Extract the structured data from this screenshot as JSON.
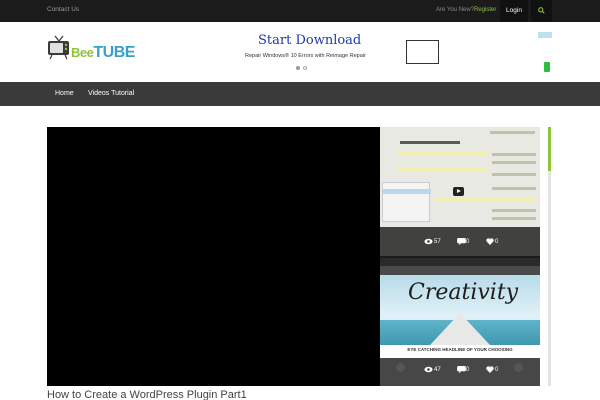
{
  "topbar": {
    "contact": "Contact Us",
    "new_user": "Are You New?",
    "register": "Register",
    "login": "Login"
  },
  "header": {
    "logo": {
      "text_prefix": "Bee",
      "text_main": "TUBE"
    }
  },
  "ad": {
    "title": "Start Download",
    "subtitle": "Repair Windows® 10 Errors with Reimage Repair"
  },
  "nav": {
    "items": [
      {
        "label": "Home"
      },
      {
        "label": "Videos Tutorial"
      }
    ]
  },
  "playlist": {
    "items": [
      {
        "views": "57",
        "comments": "0",
        "likes": "0"
      },
      {
        "views": "47",
        "comments": "0",
        "likes": "0",
        "image_text": "Creativity",
        "headline": "EYE CATCHING HEADLINE OF YOUR CHOOSING"
      }
    ]
  },
  "video": {
    "title": "How to Create a WordPress Plugin Part1"
  },
  "colors": {
    "accent": "#8fc33a",
    "topbar_bg": "#1b1b1b",
    "nav_bg": "#3a3a3a"
  }
}
